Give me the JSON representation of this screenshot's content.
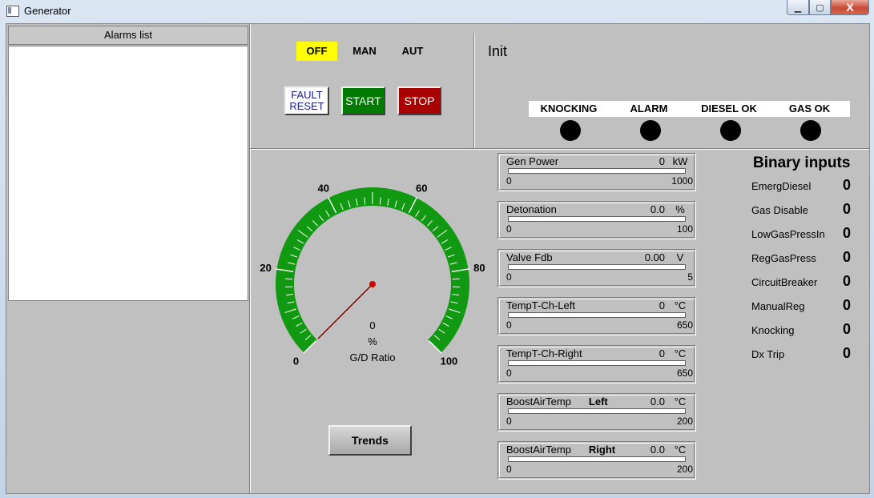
{
  "window": {
    "title": "Generator",
    "icon": "window-app-icon",
    "min_glyph": "▁",
    "max_glyph": "▢",
    "close_glyph": "X"
  },
  "alarms": {
    "header": "Alarms list",
    "items": []
  },
  "modes": {
    "off": "OFF",
    "man": "MAN",
    "aut": "AUT",
    "active": "OFF",
    "active_color": "#ffff00"
  },
  "controls": {
    "fault_line1": "FAULT",
    "fault_line2": "RESET",
    "start": "START",
    "stop": "STOP"
  },
  "status": {
    "state": "Init"
  },
  "indicators": [
    {
      "label": "KNOCKING",
      "state": "off"
    },
    {
      "label": "ALARM",
      "state": "off"
    },
    {
      "label": "DIESEL OK",
      "state": "off"
    },
    {
      "label": "GAS OK",
      "state": "off"
    }
  ],
  "gauge": {
    "value": "0",
    "unit": "%",
    "label": "G/D  Ratio",
    "min": 0,
    "max": 100,
    "tick_labels": [
      "0",
      "20",
      "40",
      "60",
      "80",
      "100"
    ],
    "arc_color": "#119911",
    "needle_color": "#800000"
  },
  "trends_button": "Trends",
  "meters": [
    {
      "name": "Gen Power",
      "name_bold": "",
      "value": "0",
      "unit": "kW",
      "min": "0",
      "max": "1000"
    },
    {
      "name": "Detonation",
      "name_bold": "",
      "value": "0.0",
      "unit": "%",
      "min": "0",
      "max": "100"
    },
    {
      "name": "Valve Fdb",
      "name_bold": "",
      "value": "0.00",
      "unit": "V",
      "min": "0",
      "max": "5"
    },
    {
      "name": "TempT-Ch-Left",
      "name_bold": "",
      "value": "0",
      "unit": "°C",
      "min": "0",
      "max": "650"
    },
    {
      "name": "TempT-Ch-Right",
      "name_bold": "",
      "value": "0",
      "unit": "°C",
      "min": "0",
      "max": "650"
    },
    {
      "name": "BoostAirTemp",
      "name_bold": "Left",
      "value": "0.0",
      "unit": "°C",
      "min": "0",
      "max": "200"
    },
    {
      "name": "BoostAirTemp",
      "name_bold": "Right",
      "value": "0.0",
      "unit": "°C",
      "min": "0",
      "max": "200"
    }
  ],
  "binary_inputs": {
    "title": "Binary inputs",
    "items": [
      {
        "name": "EmergDiesel",
        "value": "0"
      },
      {
        "name": "Gas Disable",
        "value": "0"
      },
      {
        "name": "LowGasPressIn",
        "value": "0"
      },
      {
        "name": "RegGasPress",
        "value": "0"
      },
      {
        "name": "CircuitBreaker",
        "value": "0"
      },
      {
        "name": "ManualReg",
        "value": "0"
      },
      {
        "name": "Knocking",
        "value": "0"
      },
      {
        "name": "Dx Trip",
        "value": "0"
      }
    ]
  }
}
